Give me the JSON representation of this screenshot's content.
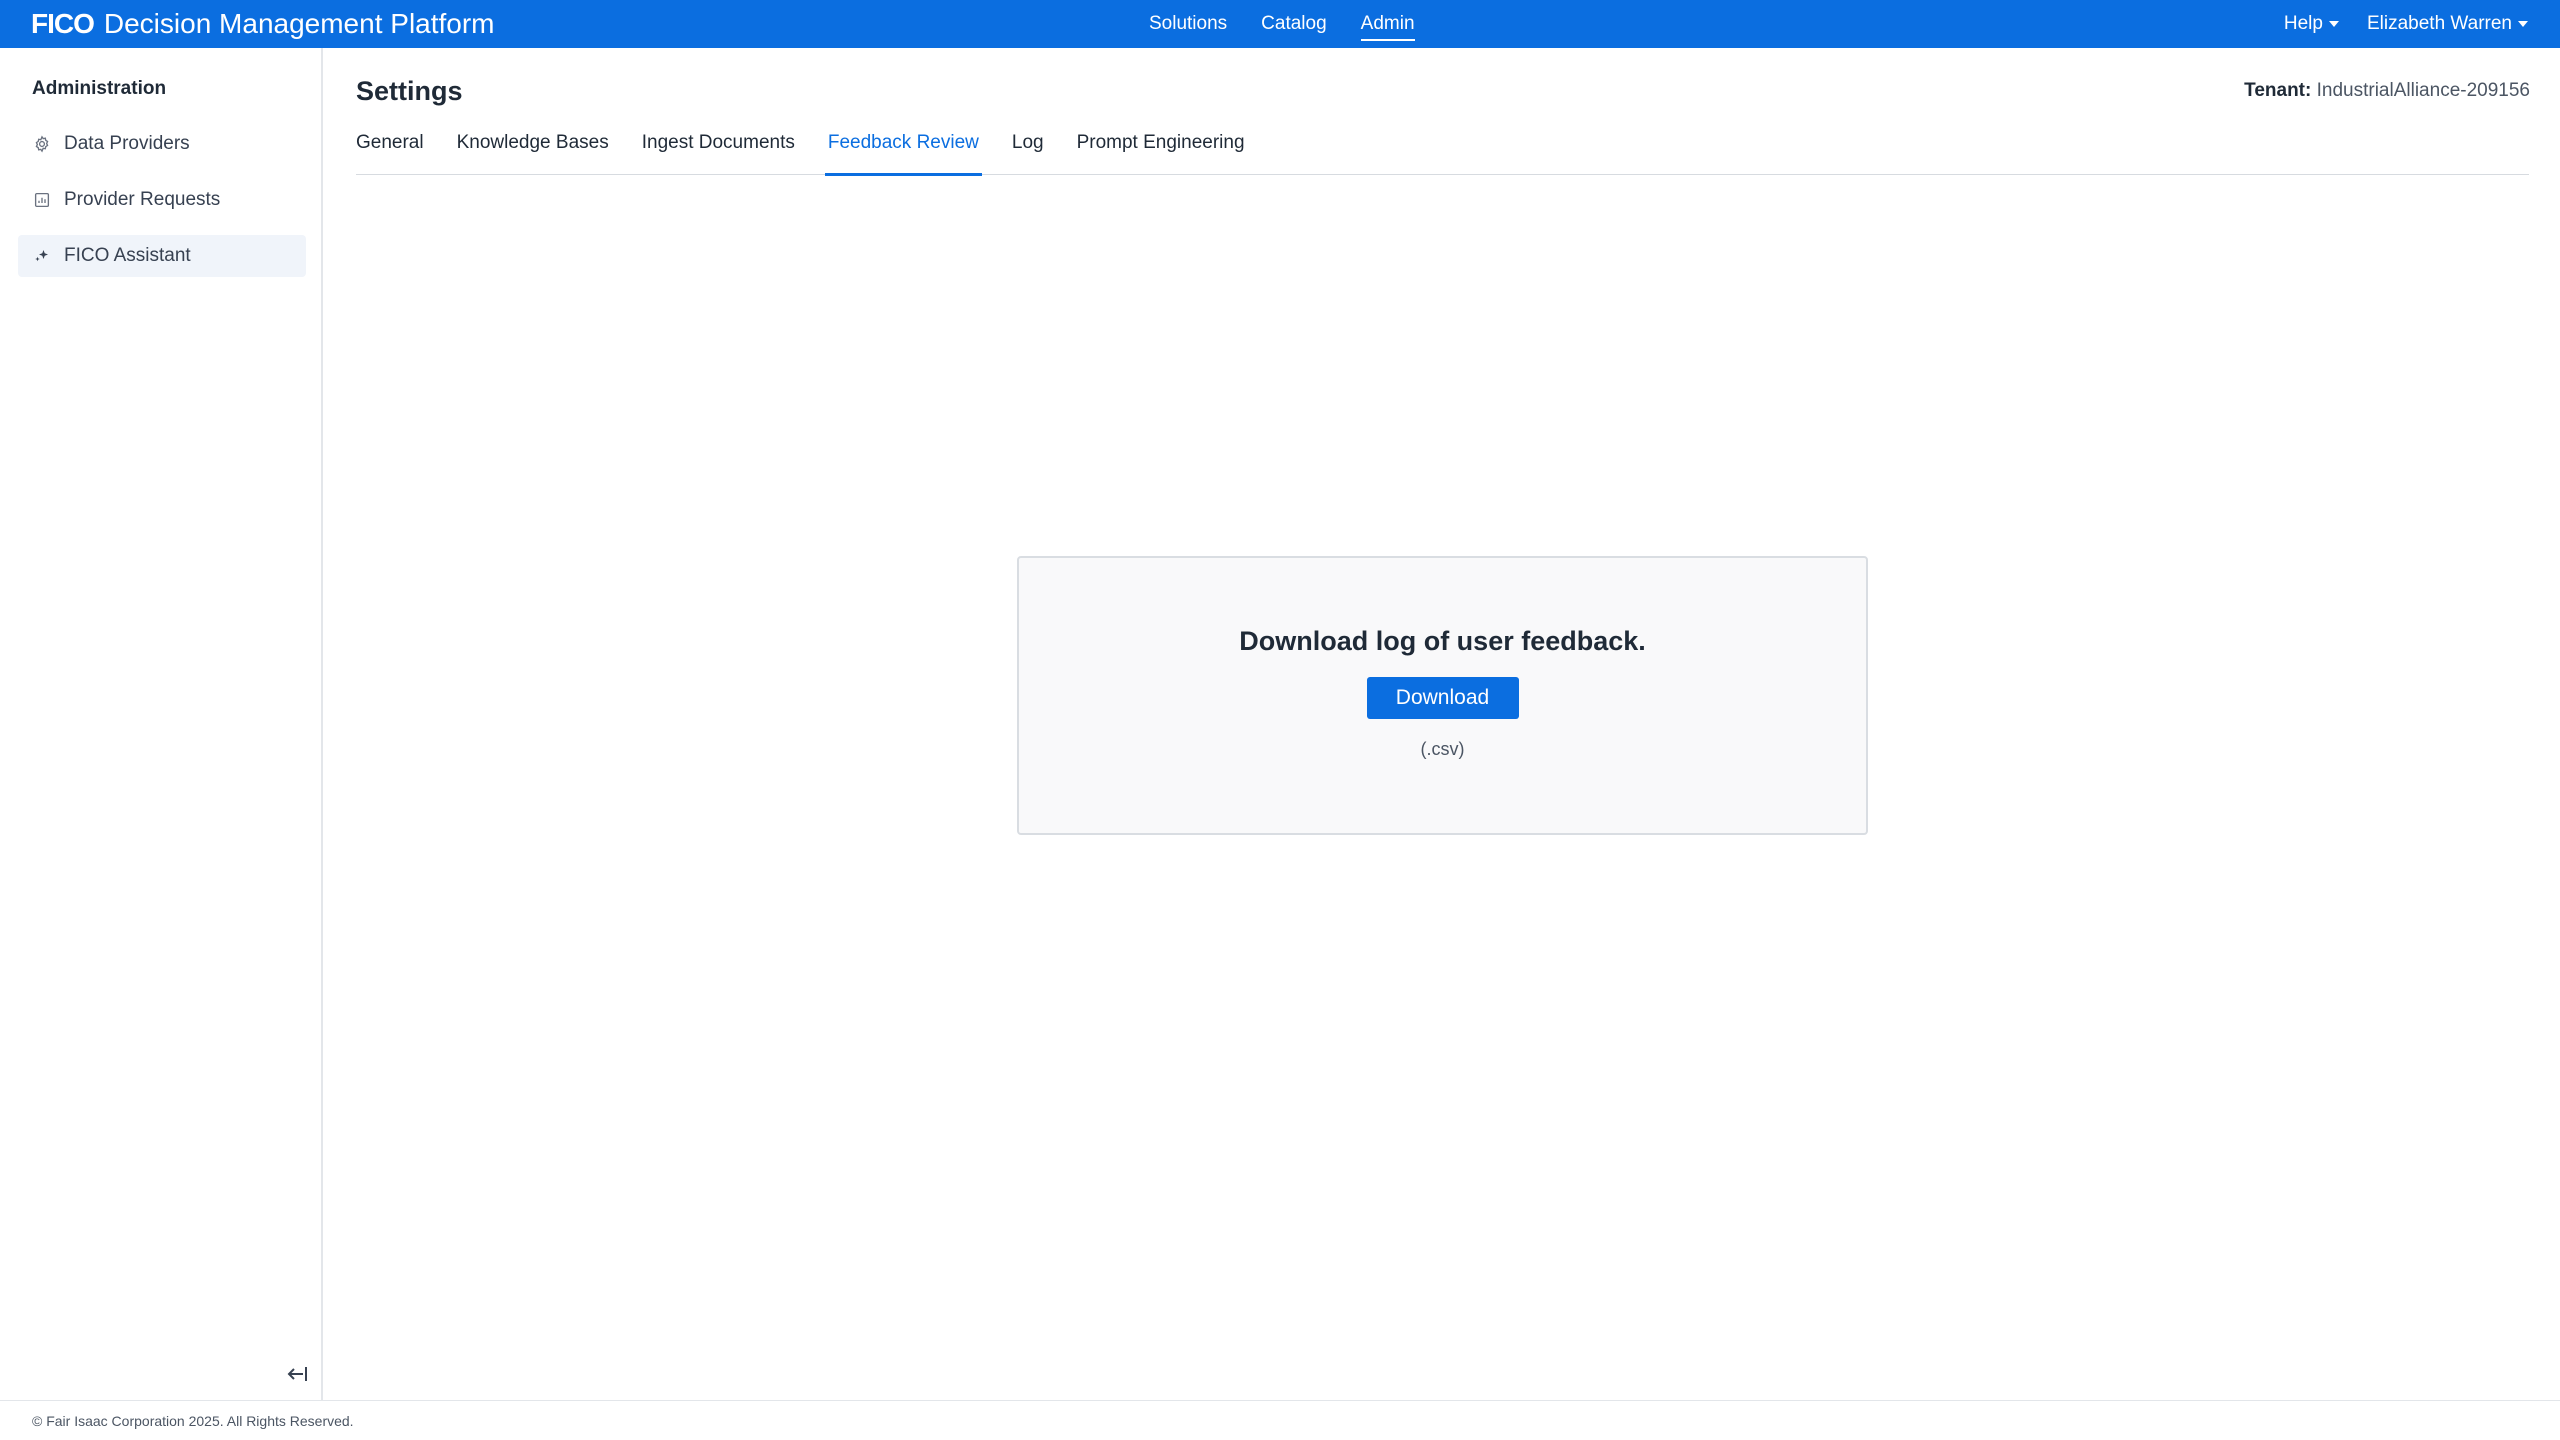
{
  "header": {
    "brand_logo": "FICO",
    "brand_name": "Decision Management Platform",
    "nav": [
      {
        "label": "Solutions"
      },
      {
        "label": "Catalog"
      },
      {
        "label": "Admin"
      }
    ],
    "active_nav": "Admin",
    "help_label": "Help",
    "user_name": "Elizabeth Warren"
  },
  "sidebar": {
    "title": "Administration",
    "items": [
      {
        "label": "Data Providers",
        "icon": "gear-icon"
      },
      {
        "label": "Provider Requests",
        "icon": "report-icon"
      },
      {
        "label": "FICO Assistant",
        "icon": "sparkle-icon"
      }
    ],
    "active_item": "FICO Assistant",
    "collapse_icon": "collapse-left-icon"
  },
  "main": {
    "page_title": "Settings",
    "tenant_label": "Tenant:",
    "tenant_value": "IndustrialAlliance-209156",
    "tabs": [
      {
        "label": "General"
      },
      {
        "label": "Knowledge Bases"
      },
      {
        "label": "Ingest Documents"
      },
      {
        "label": "Feedback Review"
      },
      {
        "label": "Log"
      },
      {
        "label": "Prompt Engineering"
      }
    ],
    "active_tab": "Feedback Review",
    "card": {
      "heading": "Download log of user feedback.",
      "button_label": "Download",
      "note": "(.csv)"
    }
  },
  "footer": {
    "text": "© Fair Isaac Corporation 2025. All Rights Reserved."
  },
  "colors": {
    "primary": "#0b6ee0",
    "text": "#1f2a37",
    "muted": "#4b5563",
    "active_bg": "#f0f4fa"
  }
}
